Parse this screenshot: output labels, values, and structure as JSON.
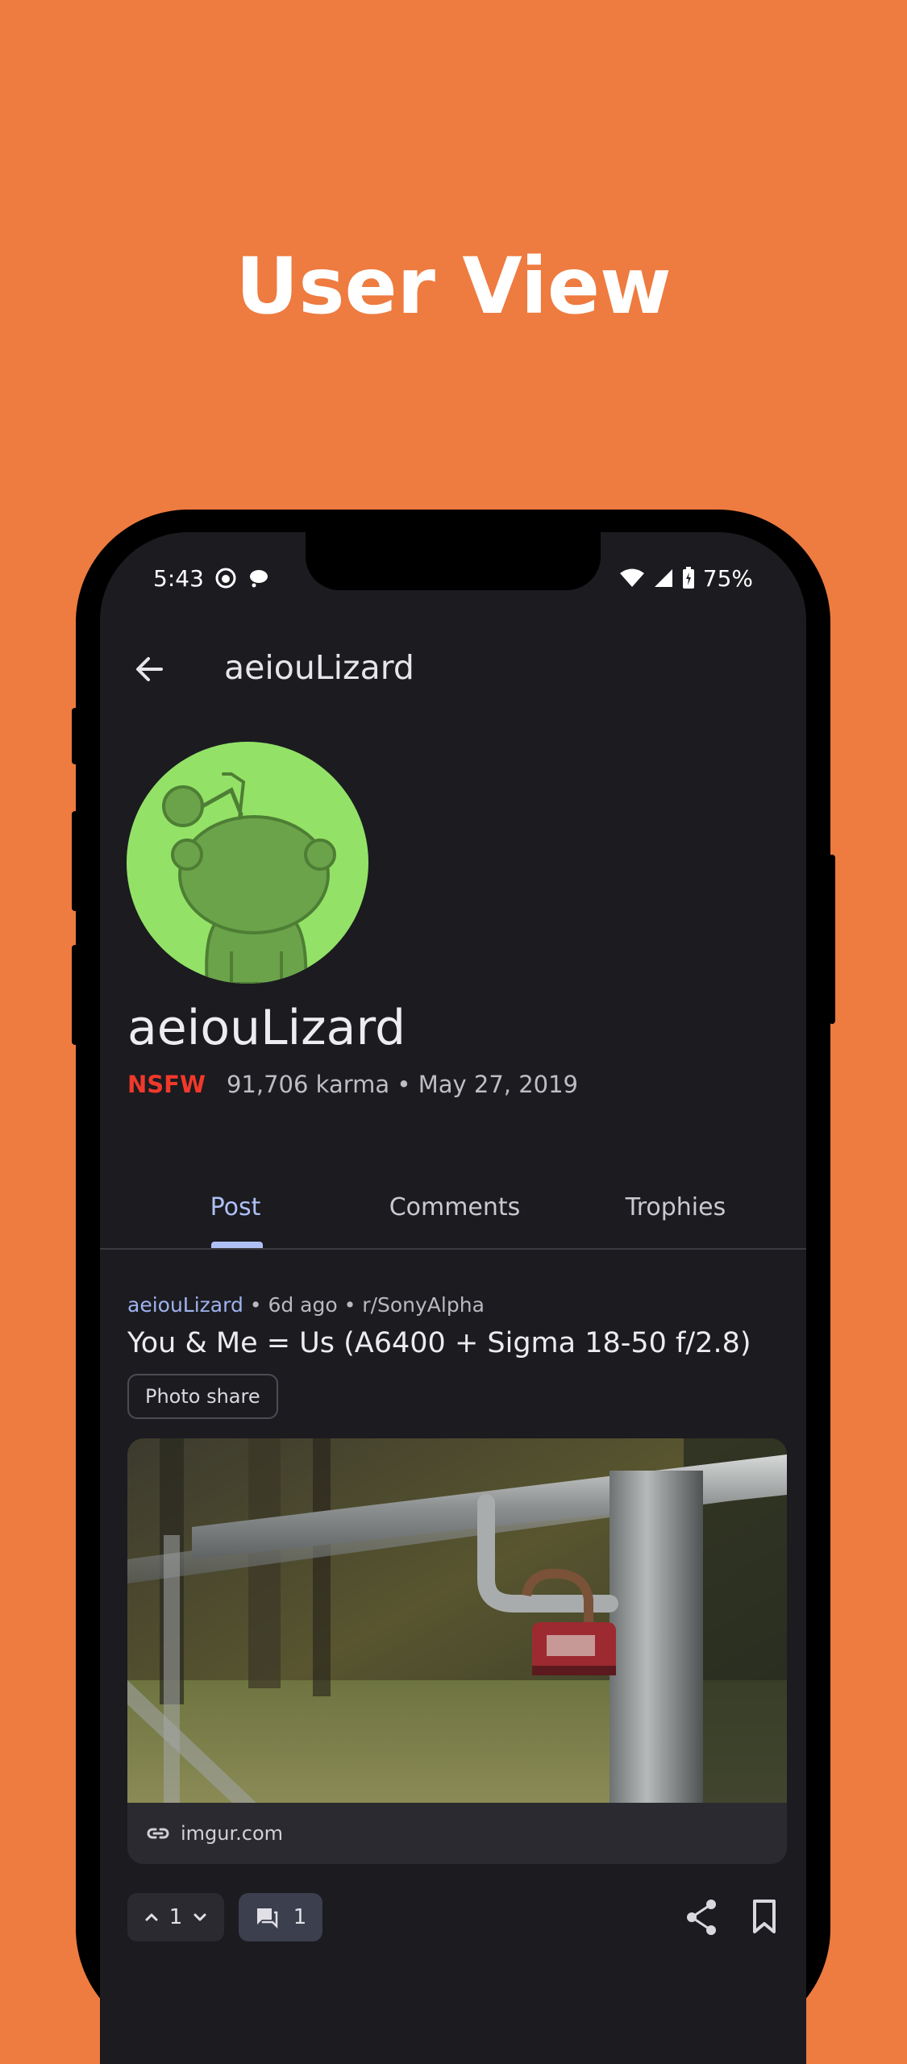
{
  "headline": "User View",
  "status_bar": {
    "time": "5:43",
    "battery": "75%"
  },
  "app_bar": {
    "title": "aeiouLizard"
  },
  "profile": {
    "username": "aeiouLizard",
    "nsfw_label": "NSFW",
    "karma_date": "91,706 karma • May 27, 2019",
    "avatar_color": "#93E267"
  },
  "tabs": [
    {
      "label": "Post",
      "active": true
    },
    {
      "label": "Comments",
      "active": false
    },
    {
      "label": "Trophies",
      "active": false
    }
  ],
  "post": {
    "author": "aeiouLizard",
    "meta_rest": " • 6d ago • r/SonyAlpha",
    "title": "You & Me = Us (A6400 + Sigma 18-50 f/2.8)",
    "flair": "Photo share",
    "link_domain": "imgur.com",
    "score": "1",
    "comments": "1"
  },
  "colors": {
    "background": "#EE7B40",
    "screen": "#1B1B20",
    "accent": "#AFC0F5",
    "nsfw": "#F0392B"
  },
  "icons": [
    "back-arrow-icon",
    "upvote-icon",
    "downvote-icon",
    "comment-icon",
    "share-icon",
    "bookmark-icon",
    "link-icon",
    "wifi-icon",
    "signal-icon",
    "battery-icon"
  ]
}
